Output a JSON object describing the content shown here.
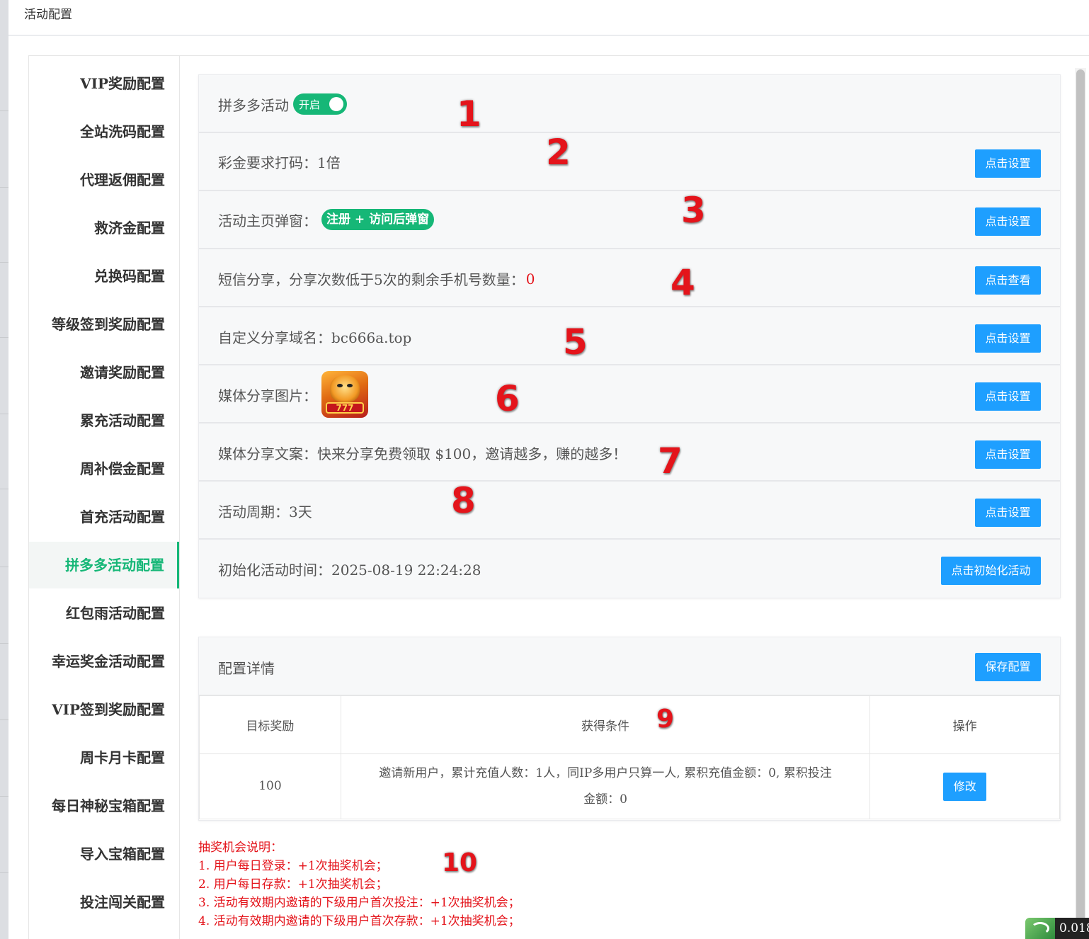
{
  "header": {
    "title": "活动配置"
  },
  "sidebar": {
    "items": [
      {
        "label": "VIP奖励配置",
        "active": false
      },
      {
        "label": "全站洗码配置",
        "active": false
      },
      {
        "label": "代理返佣配置",
        "active": false
      },
      {
        "label": "救济金配置",
        "active": false
      },
      {
        "label": "兑换码配置",
        "active": false
      },
      {
        "label": "等级签到奖励配置",
        "active": false
      },
      {
        "label": "邀请奖励配置",
        "active": false
      },
      {
        "label": "累充活动配置",
        "active": false
      },
      {
        "label": "周补偿金配置",
        "active": false
      },
      {
        "label": "首充活动配置",
        "active": false
      },
      {
        "label": "拼多多活动配置",
        "active": true
      },
      {
        "label": "红包雨活动配置",
        "active": false
      },
      {
        "label": "幸运奖金活动配置",
        "active": false
      },
      {
        "label": "VIP签到奖励配置",
        "active": false
      },
      {
        "label": "周卡月卡配置",
        "active": false
      },
      {
        "label": "每日神秘宝箱配置",
        "active": false
      },
      {
        "label": "导入宝箱配置",
        "active": false
      },
      {
        "label": "投注闯关配置",
        "active": false
      }
    ],
    "active_color": "#16b777"
  },
  "settings": {
    "activity": {
      "label": "拼多多活动",
      "toggle_label": "开启",
      "toggle_on": true
    },
    "bonus_wager": {
      "label": "彩金要求打码：1倍",
      "button": "点击设置"
    },
    "popup": {
      "label": "活动主页弹窗：",
      "badge": "注册 + 访问后弹窗",
      "button": "点击设置"
    },
    "sms": {
      "label": "短信分享，分享次数低于5次的剩余手机号数量：",
      "value": "0",
      "button": "点击查看"
    },
    "domain": {
      "label": "自定义分享域名：bc666a.top",
      "button": "点击设置"
    },
    "media_image": {
      "label": "媒体分享图片：",
      "image_icon": "tiger-777-icon",
      "image_text": "777",
      "button": "点击设置"
    },
    "media_text": {
      "label": "媒体分享文案：快来分享免费领取 $100，邀请越多，赚的越多！",
      "button": "点击设置"
    },
    "period": {
      "label": "活动周期：3天",
      "button": "点击设置"
    },
    "init": {
      "label": "初始化活动时间：2025-08-19 22:24:28",
      "button": "点击初始化活动"
    }
  },
  "detail": {
    "title": "配置详情",
    "save_button": "保存配置",
    "columns": [
      "目标奖励",
      "获得条件",
      "操作"
    ],
    "rows": [
      {
        "reward": "100",
        "condition_line1": "邀请新用户，累计充值人数：1人，同IP多用户只算一人, 累积充值金额：0, 累积投注",
        "condition_line2": "金额：0",
        "action": "修改"
      }
    ]
  },
  "notes": {
    "title": "抽奖机会说明：",
    "lines": [
      "1. 用户每日登录：+1次抽奖机会；",
      "2. 用户每日存款：+1次抽奖机会；",
      "3. 活动有效期内邀请的下级用户首次投注：+1次抽奖机会；",
      "4. 活动有效期内邀请的下级用户首次存款：+1次抽奖机会；"
    ]
  },
  "annotations": [
    "1",
    "2",
    "3",
    "4",
    "5",
    "6",
    "7",
    "8",
    "9",
    "10"
  ],
  "corner": {
    "badge_icon": "app-logo-icon",
    "timer": "0.018"
  },
  "colors": {
    "primary_button": "#1e9fff",
    "success": "#16b777",
    "danger": "#e4141b"
  }
}
